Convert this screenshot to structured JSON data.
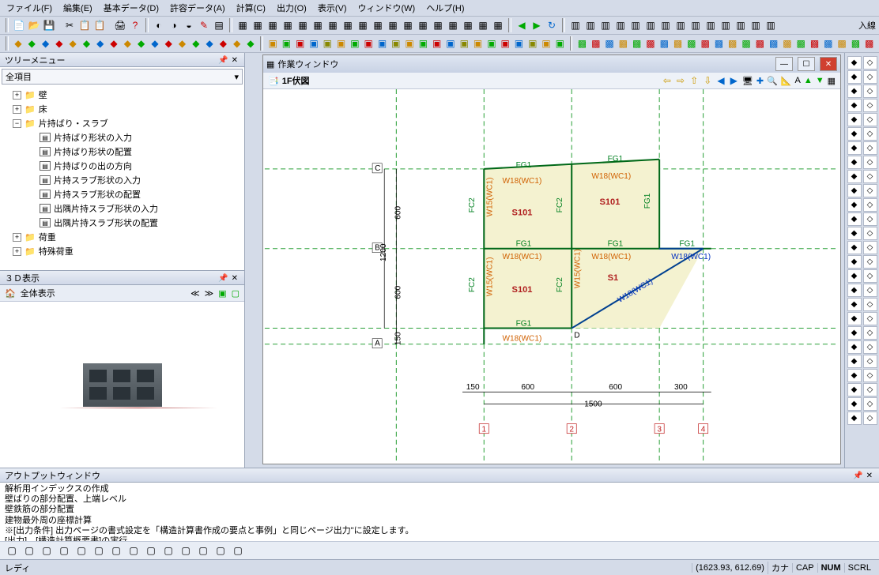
{
  "menu": {
    "file": "ファイル(F)",
    "edit": "編集(E)",
    "basedata": "基本データ(D)",
    "permdata": "許容データ(A)",
    "calc": "計算(C)",
    "output": "出力(O)",
    "view": "表示(V)",
    "window": "ウィンドウ(W)",
    "help": "ヘルプ(H)"
  },
  "tree": {
    "title": "ツリーメニュー",
    "select_label": "全項目",
    "items": [
      {
        "level": 1,
        "exp": "+",
        "icon": "folder",
        "label": "壁"
      },
      {
        "level": 1,
        "exp": "+",
        "icon": "folder",
        "label": "床"
      },
      {
        "level": 1,
        "exp": "−",
        "icon": "folder",
        "label": "片持ばり・スラブ"
      },
      {
        "level": 2,
        "leaficon": "form",
        "label": "片持ばり形状の入力"
      },
      {
        "level": 2,
        "leaficon": "grid",
        "label": "片持ばり形状の配置"
      },
      {
        "level": 2,
        "leaficon": "grid",
        "label": "片持ばりの出の方向"
      },
      {
        "level": 2,
        "leaficon": "form",
        "label": "片持スラブ形状の入力"
      },
      {
        "level": 2,
        "leaficon": "grid",
        "label": "片持スラブ形状の配置"
      },
      {
        "level": 2,
        "leaficon": "form",
        "label": "出隅片持スラブ形状の入力"
      },
      {
        "level": 2,
        "leaficon": "grid",
        "label": "出隅片持スラブ形状の配置"
      },
      {
        "level": 1,
        "exp": "+",
        "icon": "folder",
        "label": "荷重"
      },
      {
        "level": 1,
        "exp": "+",
        "icon": "folder",
        "label": "特殊荷重"
      }
    ]
  },
  "view3d": {
    "title": "３Ｄ表示",
    "label": "全体表示"
  },
  "workwin": {
    "title": "作業ウィンドウ",
    "floor": "1F伏図"
  },
  "plan": {
    "grid_y": [
      "C",
      "B",
      "A"
    ],
    "grid_y_box": [
      "C",
      "B",
      "A"
    ],
    "dim_y": [
      "600",
      "600",
      "150"
    ],
    "dim_y_total": "1200",
    "dim_x": [
      "150",
      "600",
      "600",
      "300"
    ],
    "dim_x_total": "1500",
    "bottom_nums": [
      "1",
      "2",
      "3",
      "4"
    ],
    "labels": {
      "fg1_top_left": "FG1",
      "fg1_top_right": "FG1",
      "fg1_mid_left": "FG1",
      "fg1_mid_right": "FG1",
      "fg1_mid_far": "FG1",
      "fg1_bot_left": "FG1",
      "fc2_left": "FC2",
      "fc2_left2": "FC2",
      "fc2_mid": "FC2",
      "fc2_mid2": "FC2",
      "fc2_right": "FG1",
      "s101_a": "S101",
      "s101_b": "S101",
      "s101_c": "S101",
      "s1": "S1",
      "w18_tl": "W18(WC1)",
      "w18_tr": "W18(WC1)",
      "w18_ml": "W18(WC1)",
      "w18_mr": "W18(WC1)",
      "w18_bl": "W18(WC1)",
      "w18_br": "W18(WC1)",
      "w15_1": "W15(WC1)",
      "w15_mid": "W15(WC1)",
      "w15_2": "W15(WC1)",
      "d_label": "D",
      "diag": "W18(WC1)"
    }
  },
  "output": {
    "title": "アウトプットウィンドウ",
    "lines": "解析用インデックスの作成\n壁ばりの部分配置、上端レベル\n壁鉄筋の部分配置\n建物最外周の座標計算\n※[出力条件] 出力ページの書式設定を「構造計算書作成の要点と事例」と同じページ出力\"に設定します。\n[出力]→[構造計算概要書]の実行"
  },
  "status": {
    "ready": "レディ",
    "coords": "(1623.93, 612.69)",
    "kana": "カナ",
    "cap": "CAP",
    "num": "NUM",
    "scrl": "SCRL"
  },
  "input_label": "入線"
}
